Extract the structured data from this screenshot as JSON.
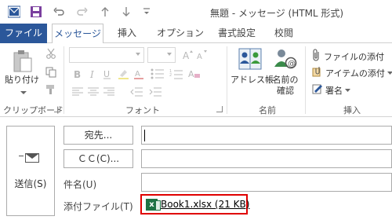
{
  "window": {
    "title": "無題 - メッセージ (HTML 形式)"
  },
  "tabs": [
    "ファイル",
    "メッセージ",
    "挿入",
    "オプション",
    "書式設定",
    "校閲"
  ],
  "ribbon": {
    "clipboard": {
      "paste_label": "貼り付け",
      "group_label": "クリップボード"
    },
    "font": {
      "group_label": "フォント"
    },
    "names": {
      "address_book_label": "アドレス帳",
      "check_names_label_line1": "名前の",
      "check_names_label_line2": "確認",
      "group_label": "名前"
    },
    "insert": {
      "attach_file_label": "ファイルの添付",
      "attach_item_label": "アイテムの添付",
      "signature_label": "署名",
      "group_label": "挿入"
    }
  },
  "compose": {
    "send_label": "送信(S)",
    "to_button": "宛先...",
    "cc_button": "ＣＣ(C)...",
    "subject_label": "件名(U)",
    "attachment_label": "添付ファイル(T)",
    "attachment_file": "Book1.xlsx (21 KB)",
    "to_value": "",
    "cc_value": "",
    "subject_value": ""
  }
}
